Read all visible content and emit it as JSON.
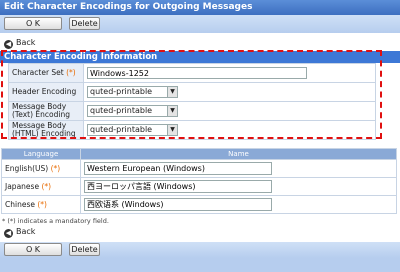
{
  "title": "Edit Character Encodings for Outgoing Messages",
  "toolbar": {
    "ok_label": "O K",
    "delete_label": "Delete"
  },
  "back_label": "Back",
  "section": {
    "header": "Character Encoding Information",
    "rows": [
      {
        "label": "Character Set",
        "required": "(*)",
        "value": "Windows-1252",
        "kind": "text"
      },
      {
        "label": "Header Encoding",
        "value": "quted-printable",
        "kind": "select"
      },
      {
        "label": "Message Body (Text) Encoding",
        "value": "quted-printable",
        "kind": "select"
      },
      {
        "label": "Message Body (HTML) Encoding",
        "value": "quted-printable",
        "kind": "select"
      }
    ]
  },
  "languages": {
    "headers": [
      "Language",
      "Name"
    ],
    "rows": [
      {
        "lang": "English(US)",
        "required": "(*)",
        "name": "Western European (Windows)"
      },
      {
        "lang": "Japanese",
        "required": "(*)",
        "name": "西ヨーロッパ言語 (Windows)"
      },
      {
        "lang": "Chinese",
        "required": "(*)",
        "name": "西欧语系 (Windows)"
      }
    ]
  },
  "mandatory_note": "* (*) indicates a mandatory field.",
  "colors": {
    "accent": "#3d78d6",
    "highlight": "#e01010",
    "required": "#e86a00"
  }
}
